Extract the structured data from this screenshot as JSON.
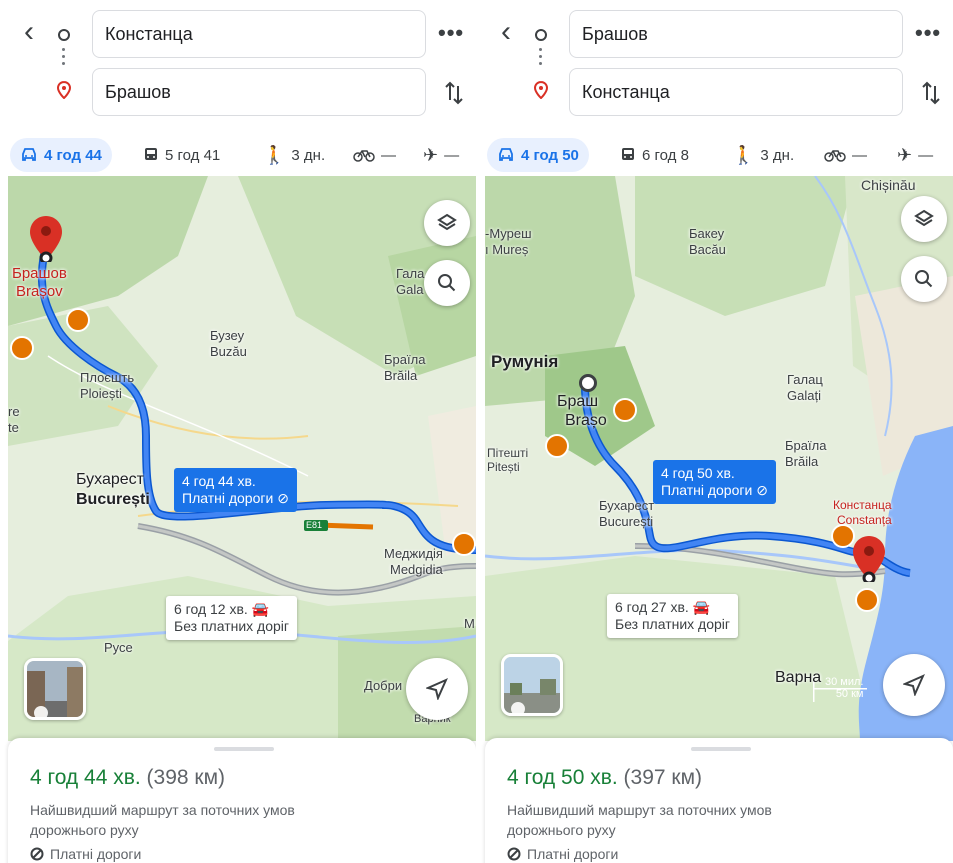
{
  "left": {
    "origin": "Констанца",
    "destination": "Брашов",
    "modes": {
      "car": "4 год 44",
      "transit": "5 год 41",
      "walk": "3 дн.",
      "bike": "—",
      "flight": "—"
    },
    "map_labels": {
      "brasov_ua": "Брашов",
      "brasov": "Brașov",
      "buzau_ua": "Бузеу",
      "buzau": "Buzău",
      "ploiesti_ua": "Плоєшть",
      "ploiesti": "Ploiești",
      "bucharest_ua": "Бухарест",
      "bucharest": "București",
      "galati_ua": "Гала",
      "galati": "Gala",
      "braila_ua": "Браїла",
      "braila": "Brăila",
      "medgidia_ua": "Меджидія",
      "medgidia": "Medgidia",
      "ruse": "Русе",
      "dobrich": "Добри",
      "varna_part": "Варник",
      "left_edge1": "re",
      "left_edge2": "te",
      "road": "E81",
      "m": "M"
    },
    "route_callout": {
      "time": "4 год 44 хв.",
      "toll": "Платні дороги"
    },
    "alt_callout": {
      "time": "6 год 12 хв.",
      "notoll": "Без платних доріг"
    },
    "summary": {
      "time": "4 год 44 хв.",
      "distance": "(398 км)"
    },
    "description": "Найшвидший маршрут за поточних умов дорожнього руху",
    "toll_label": "Платні дороги"
  },
  "right": {
    "origin": "Брашов",
    "destination": "Констанца",
    "modes": {
      "car": "4 год 50",
      "transit": "6 год 8",
      "walk": "3 дн.",
      "bike": "—",
      "flight": "—"
    },
    "map_labels": {
      "chisinau": "Chișinău",
      "muresh_ua": "-Муреш",
      "mures": "ı Mureș",
      "bacau_ua": "Бакеу",
      "bacau": "Bacău",
      "romania": "Румунія",
      "brasov_ua": "Браш",
      "brasov": "Brașo",
      "galati_ua": "Галац",
      "galati": "Galați",
      "braila_ua": "Браїла",
      "braila": "Brăila",
      "pitesti_ua": "Пітешті",
      "pitesti": "Pitești",
      "bucharest_ua": "Бухарест",
      "bucharest": "București",
      "constanta_ua": "Констанца",
      "constanta": "Constanța",
      "varna": "Варна"
    },
    "route_callout": {
      "time": "4 год 50 хв.",
      "toll": "Платні дороги"
    },
    "alt_callout": {
      "time": "6 год 27 хв.",
      "notoll": "Без платних доріг"
    },
    "scale": {
      "mi": "30 мил.",
      "km": "50 км"
    },
    "summary": {
      "time": "4 год 50 хв.",
      "distance": "(397 км)"
    },
    "description": "Найшвидший маршрут за поточних умов дорожнього руху",
    "toll_label": "Платні дороги"
  },
  "colors": {
    "route": "#1a73e8",
    "alt_route": "#9aa0a6",
    "accent_green": "#188038",
    "pin_red": "#d93025",
    "camera_orange": "#e37400",
    "map_green": "#cfe5c1",
    "map_light": "#e8f0e0",
    "sea": "#8ab4f8"
  }
}
